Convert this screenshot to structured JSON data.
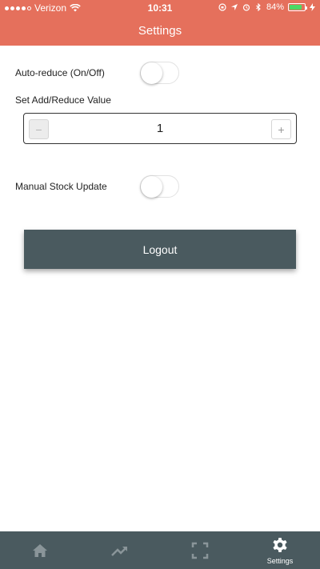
{
  "status_bar": {
    "carrier": "Verizon",
    "time": "10:31",
    "battery": "84%",
    "battery_level": 0.84,
    "signal_bars": 4
  },
  "header": {
    "title": "Settings"
  },
  "settings": {
    "auto_reduce_label": "Auto-reduce (On/Off)",
    "auto_reduce_on": false,
    "set_value_label": "Set Add/Reduce Value",
    "stepper_value": "1",
    "stepper_minus": "−",
    "stepper_plus": "+",
    "manual_stock_label": "Manual Stock Update",
    "manual_stock_on": false,
    "logout_label": "Logout"
  },
  "tabbar": {
    "settings_label": "Settings",
    "icons": [
      "home-icon",
      "trending-icon",
      "scan-icon",
      "gear-icon"
    ]
  },
  "colors": {
    "header": "#e5705c",
    "tabbar": "#4a5a5f",
    "button": "#4a5a5f"
  }
}
